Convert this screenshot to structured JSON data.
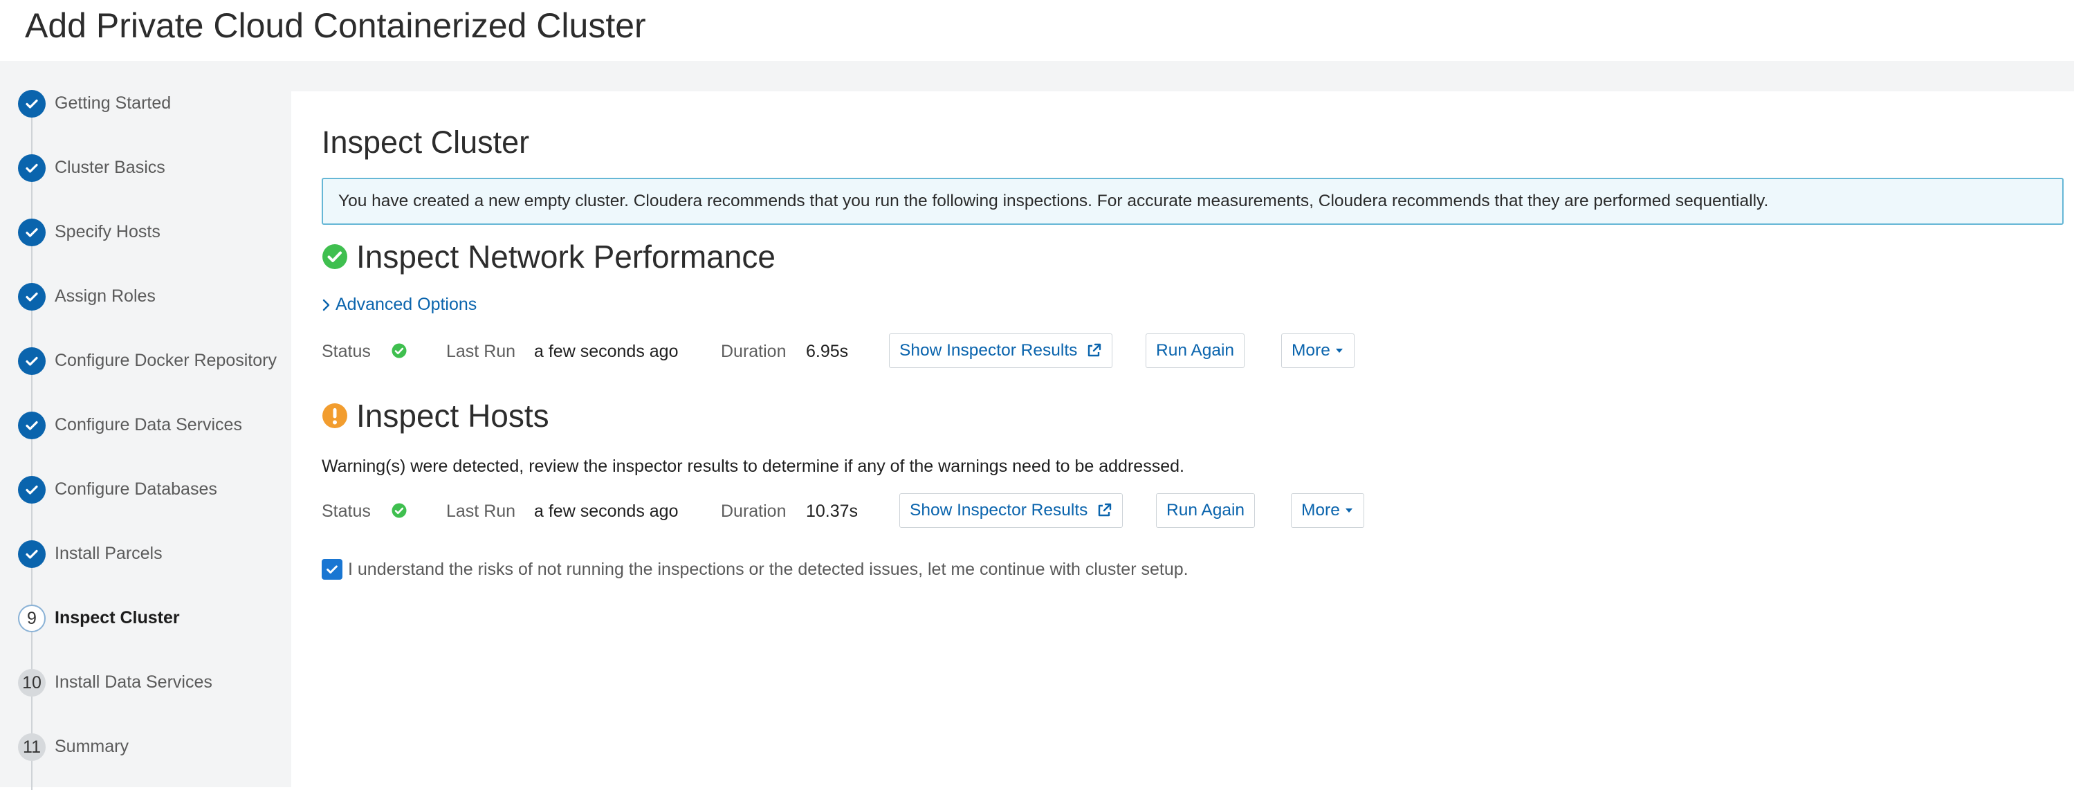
{
  "header": {
    "title": "Add Private Cloud Containerized Cluster"
  },
  "wizard": {
    "steps": [
      {
        "label": "Getting Started",
        "status": "done"
      },
      {
        "label": "Cluster Basics",
        "status": "done"
      },
      {
        "label": "Specify Hosts",
        "status": "done"
      },
      {
        "label": "Assign Roles",
        "status": "done"
      },
      {
        "label": "Configure Docker Repository",
        "status": "done"
      },
      {
        "label": "Configure Data Services",
        "status": "done"
      },
      {
        "label": "Configure Databases",
        "status": "done"
      },
      {
        "label": "Install Parcels",
        "status": "done"
      },
      {
        "label": "Inspect Cluster",
        "status": "current",
        "number": "9"
      },
      {
        "label": "Install Data Services",
        "status": "todo",
        "number": "10"
      },
      {
        "label": "Summary",
        "status": "todo",
        "number": "11"
      }
    ]
  },
  "main": {
    "title": "Inspect Cluster",
    "info": "You have created a new empty cluster. Cloudera recommends that you run the following inspections. For accurate measurements, Cloudera recommends that they are performed sequentially.",
    "network": {
      "title": "Inspect Network Performance",
      "status_icon": "check-circle-icon",
      "advanced_options": "Advanced Options",
      "status_label": "Status",
      "last_run_label": "Last Run",
      "last_run": "a few seconds ago",
      "duration_label": "Duration",
      "duration": "6.95s",
      "show_results": "Show Inspector Results",
      "run_again": "Run Again",
      "more": "More"
    },
    "hosts": {
      "title": "Inspect Hosts",
      "status_icon": "warning-circle-icon",
      "warning": "Warning(s) were detected, review the inspector results to determine if any of the warnings need to be addressed.",
      "status_label": "Status",
      "last_run_label": "Last Run",
      "last_run": "a few seconds ago",
      "duration_label": "Duration",
      "duration": "10.37s",
      "show_results": "Show Inspector Results",
      "run_again": "Run Again",
      "more": "More"
    },
    "acknowledge": {
      "checked": true,
      "text": "I understand the risks of not running the inspections or the detected issues, let me continue with cluster setup."
    }
  },
  "colors": {
    "brand_blue": "#0a64ad",
    "success_green": "#3fbf4f",
    "warning_orange": "#f29d2f",
    "info_border": "#66b7d6",
    "info_bg": "#eef8fc"
  }
}
